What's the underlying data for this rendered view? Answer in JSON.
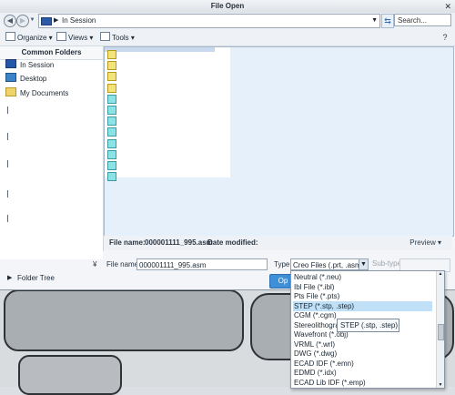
{
  "window": {
    "title": "File Open",
    "close_glyph": "✕"
  },
  "nav": {
    "back_glyph": "◀",
    "forward_glyph": "▶",
    "dropdown_glyph": "▼"
  },
  "address": {
    "location": "In Session",
    "separator": "▶",
    "dropdown_glyph": "▼",
    "search_placeholder": "Search..."
  },
  "toolbar": {
    "organize": "Organize ▾",
    "views": "Views ▾",
    "tools": "Tools ▾",
    "help_glyph": "?"
  },
  "common_folders": {
    "heading": "Common Folders",
    "items": [
      {
        "label": "In Session",
        "icon": "monitor-icon"
      },
      {
        "label": "Desktop",
        "icon": "desktop-icon"
      },
      {
        "label": "My Documents",
        "icon": "documents-folder-icon"
      }
    ]
  },
  "files": {
    "icon_colors": [
      "yellow",
      "yellow",
      "yellow",
      "yellow",
      "cyan",
      "cyan",
      "cyan",
      "cyan",
      "cyan",
      "cyan",
      "cyan",
      "cyan"
    ]
  },
  "info": {
    "filename_label": "File name:",
    "filename_value": "000001111_995.asm",
    "modified_label": "Date modified:",
    "preview_label": "Preview ▾"
  },
  "form": {
    "file_name_label": "File name",
    "file_name_value": "000001111_995.asm",
    "type_label": "Type",
    "type_value": "Creo Files (.prt, .asm,",
    "subtype_label": "Sub-type",
    "open_button": "Op"
  },
  "folder_tree": {
    "label": "Folder Tree",
    "arrow": "▶",
    "collapse_glyph": "¥"
  },
  "type_options": [
    "Neutral (*.neu)",
    "Ibl File (*.ibl)",
    "Pts File (*.pts)",
    "STEP (*.stp, .step)",
    "CGM (*.cgm)",
    "Stereolithograp",
    "Wavefront (*.obj)",
    "VRML (*.wrl)",
    "DWG (*.dwg)",
    "ECAD IDF (*.emn)",
    "EDMD (*.idx)",
    "ECAD Lib IDF (*.emp)"
  ],
  "selected_type_index": 3,
  "tooltip": "STEP (.stp, .step)"
}
